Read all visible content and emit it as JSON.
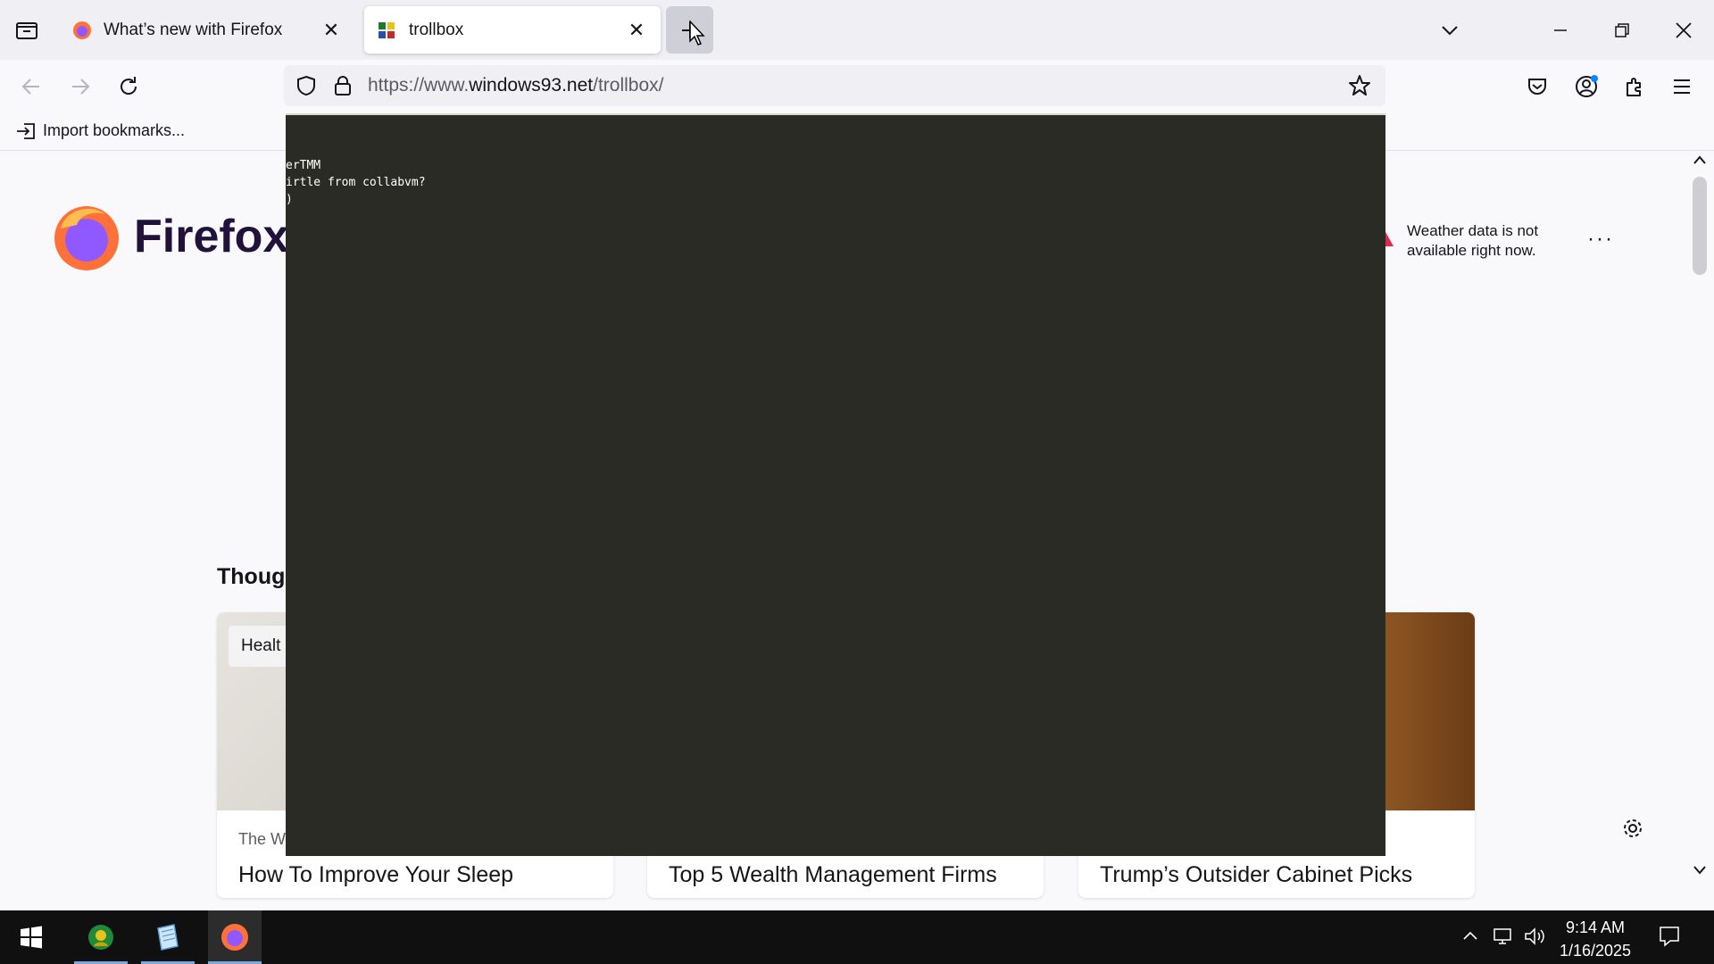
{
  "tabs": [
    {
      "title": "What’s new with Firefox",
      "favicon": "firefox-icon",
      "active": false
    },
    {
      "title": "trollbox",
      "favicon": "windows93-icon",
      "active": true
    }
  ],
  "toolbar": {
    "url_prefix": "https://www.",
    "url_domain": "windows93.net",
    "url_path": "/trollbox/"
  },
  "bookmarks": {
    "import_label": "Import bookmarks..."
  },
  "newtab_page": {
    "brand_name": "Firefox",
    "weather_message": "Weather data is not available right now.",
    "section_heading": "Thoug",
    "cards": [
      {
        "badge": "Healt",
        "source": "The W",
        "title": "How To Improve Your Sleep"
      },
      {
        "title": "Top 5 Wealth Management Firms"
      },
      {
        "title": "Trump’s Outsider Cabinet Picks"
      }
    ]
  },
  "trollbox": {
    "lines": [
      "erTMM",
      "irtle from collabvm?",
      ")"
    ]
  },
  "taskbar": {
    "time": "9:14 AM",
    "date": "1/16/2025"
  },
  "colors": {
    "overlay_bg": "#2b2b25",
    "tab_strip": "#f0f0f4",
    "taskbar_bg": "#101010",
    "firefox_orange": "#ff7139",
    "firefox_purple": "#9059ff"
  }
}
